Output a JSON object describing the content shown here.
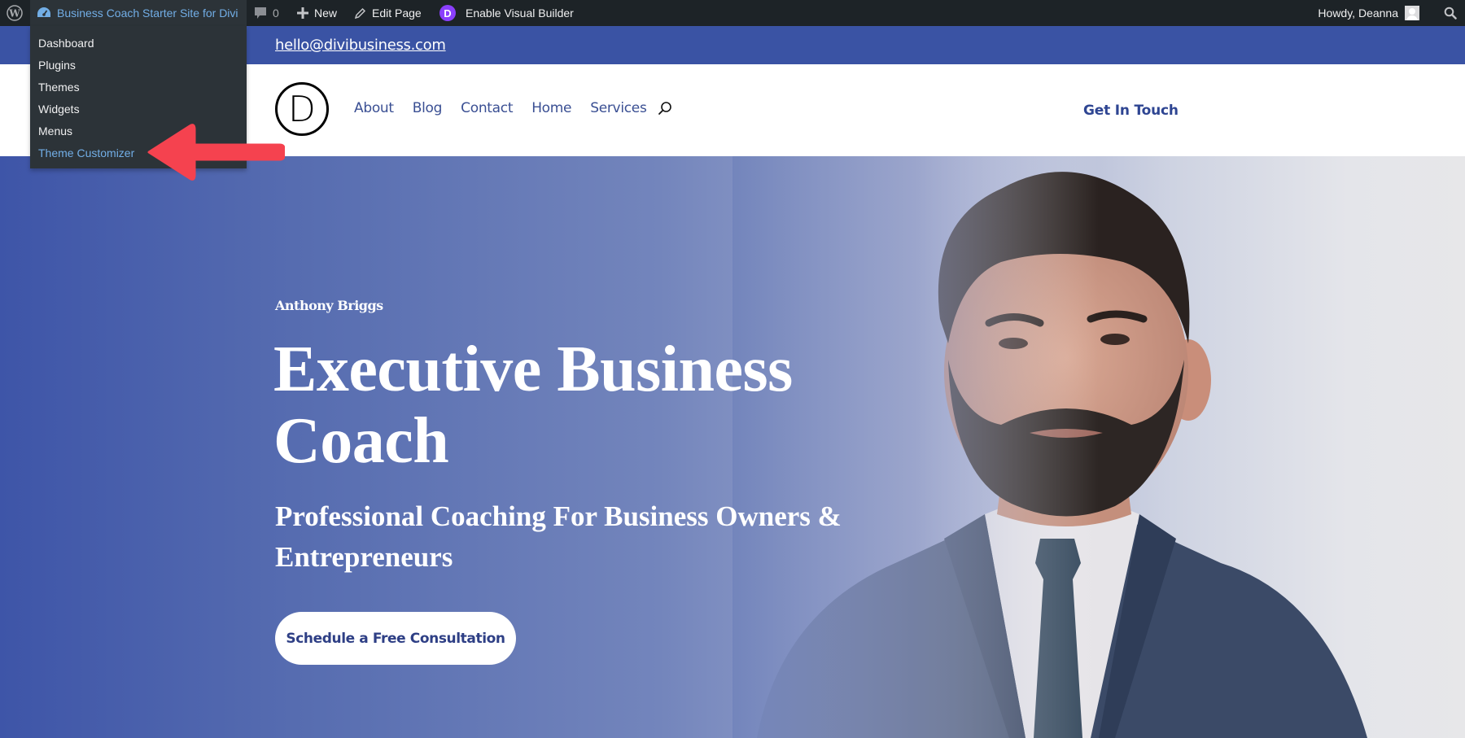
{
  "admin_bar": {
    "site_name": "Business Coach Starter Site for Divi",
    "comments_count": "0",
    "new_label": "New",
    "edit_label": "Edit Page",
    "visual_builder_label": "Enable Visual Builder",
    "divi_badge": "D",
    "howdy": "Howdy, Deanna",
    "icons": {
      "wp_logo": "wordpress-logo-icon",
      "site": "dashboard-gauge-icon",
      "comments": "comment-bubble-icon",
      "new": "plus-icon",
      "edit": "pencil-icon",
      "divi": "divi-logo-icon",
      "avatar": "user-avatar-icon",
      "search": "search-icon"
    }
  },
  "site_menu": {
    "items": [
      {
        "label": "Dashboard",
        "active": false
      },
      {
        "label": "Plugins",
        "active": false
      },
      {
        "label": "Themes",
        "active": false
      },
      {
        "label": "Widgets",
        "active": false
      },
      {
        "label": "Menus",
        "active": false
      },
      {
        "label": "Theme Customizer",
        "active": true
      }
    ],
    "annotation_color": "#f5424f"
  },
  "topbar": {
    "email": "hello@divibusiness.com"
  },
  "header": {
    "logo_letter": "D",
    "nav": [
      {
        "label": "About"
      },
      {
        "label": "Blog"
      },
      {
        "label": "Contact"
      },
      {
        "label": "Home"
      },
      {
        "label": "Services"
      }
    ],
    "cta": "Get In Touch"
  },
  "hero": {
    "name": "Anthony Briggs",
    "title": "Executive Business Coach",
    "tagline": "Professional Coaching For Business Owners & Entrepreneurs",
    "button": "Schedule a Free Consultation"
  },
  "colors": {
    "admin_bar_bg": "#1d2327",
    "admin_link": "#72aee6",
    "brand_blue": "#3a53a4",
    "nav_text": "#3a4f93",
    "cta_text": "#2e4592",
    "arrow": "#f5424f"
  }
}
